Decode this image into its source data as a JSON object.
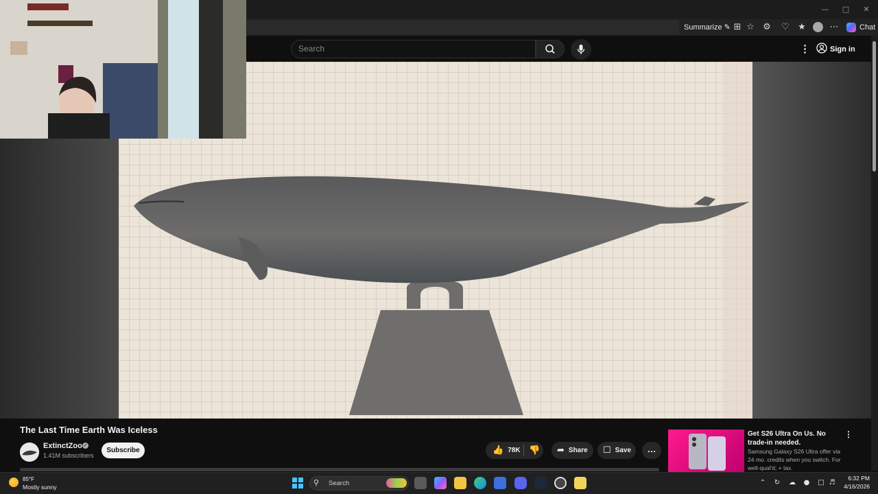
{
  "browser": {
    "summarize_label": "Summarize",
    "chat_label": "Chat",
    "minimize_glyph": "—",
    "maximize_glyph": "□",
    "close_glyph": "✕"
  },
  "youtube_header": {
    "search_placeholder": "Search",
    "sign_in_label": "Sign in"
  },
  "video": {
    "title": "The Last Time Earth Was Iceless",
    "channel_name": "ExtinctZoo",
    "subscribers": "1.41M subscribers",
    "subscribe_label": "Subscribe",
    "likes": "78K",
    "share_label": "Share",
    "save_label": "Save",
    "more_glyph": "…"
  },
  "ad": {
    "title": "Get S26 Ultra On Us. No trade-in needed.",
    "text": "Samsung Galaxy S26 Ultra offer via 24 mo. credits when you switch. For well-qual'd; + tax."
  },
  "taskbar": {
    "temperature": "85°F",
    "weather": "Mostly sunny",
    "search_label": "Search",
    "time": "6:32 PM",
    "date": "4/16/2026"
  },
  "colors": {
    "background": "#0f0f0f",
    "taskbar": "#202020",
    "windows_accent": "#4cc2ff",
    "subscribe_bg": "#f1f1f1",
    "ad_pink": "#ff1a8c"
  }
}
